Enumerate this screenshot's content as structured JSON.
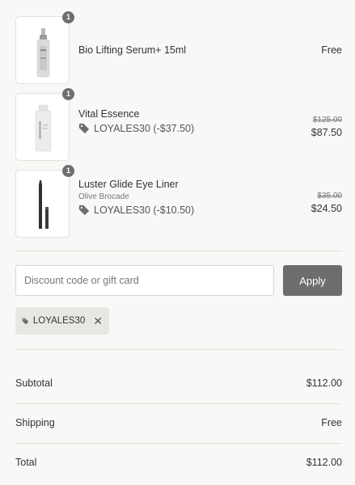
{
  "items": [
    {
      "name": "Bio Lifting Serum+ 15ml",
      "quantity": "1",
      "price": "Free",
      "image_icon": "serum-bottle"
    },
    {
      "name": "Vital Essence",
      "quantity": "1",
      "discount": "LOYALES30 (-$37.50)",
      "old_price": "$125.00",
      "price": "$87.50",
      "image_icon": "essence-bottle"
    },
    {
      "name": "Luster Glide Eye Liner",
      "variant": "Olive Brocade",
      "quantity": "1",
      "discount": "LOYALES30 (-$10.50)",
      "old_price": "$35.00",
      "price": "$24.50",
      "image_icon": "eyeliner-pencil"
    }
  ],
  "discount": {
    "placeholder": "Discount code or gift card",
    "apply_label": "Apply",
    "applied_code": "LOYALES30"
  },
  "summary": {
    "subtotal_label": "Subtotal",
    "subtotal_value": "$112.00",
    "shipping_label": "Shipping",
    "shipping_value": "Free",
    "total_label": "Total",
    "total_value": "$112.00"
  },
  "colors": {
    "background": "#f9f8f6",
    "button": "#6d6d6d",
    "chip": "#e9e7e4",
    "badge": "#6f6f6f"
  }
}
